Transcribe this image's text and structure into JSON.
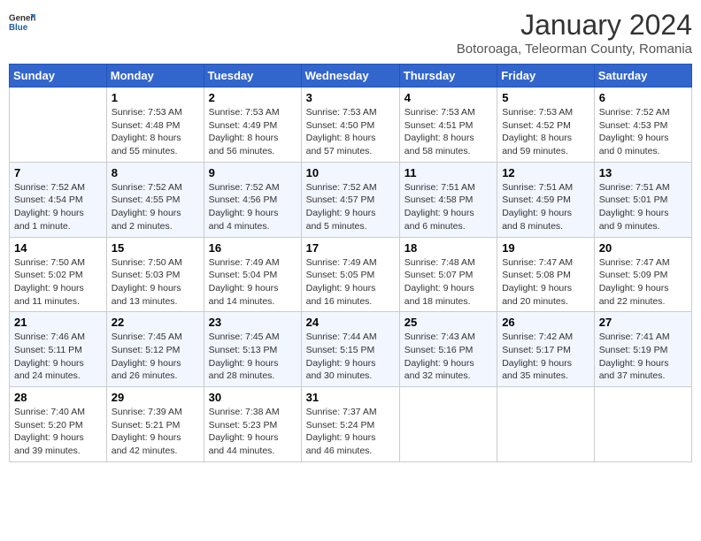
{
  "header": {
    "logo_general": "General",
    "logo_blue": "Blue",
    "title": "January 2024",
    "subtitle": "Botoroaga, Teleorman County, Romania"
  },
  "calendar": {
    "days_of_week": [
      "Sunday",
      "Monday",
      "Tuesday",
      "Wednesday",
      "Thursday",
      "Friday",
      "Saturday"
    ],
    "weeks": [
      [
        {
          "day": "",
          "info": ""
        },
        {
          "day": "1",
          "info": "Sunrise: 7:53 AM\nSunset: 4:48 PM\nDaylight: 8 hours\nand 55 minutes."
        },
        {
          "day": "2",
          "info": "Sunrise: 7:53 AM\nSunset: 4:49 PM\nDaylight: 8 hours\nand 56 minutes."
        },
        {
          "day": "3",
          "info": "Sunrise: 7:53 AM\nSunset: 4:50 PM\nDaylight: 8 hours\nand 57 minutes."
        },
        {
          "day": "4",
          "info": "Sunrise: 7:53 AM\nSunset: 4:51 PM\nDaylight: 8 hours\nand 58 minutes."
        },
        {
          "day": "5",
          "info": "Sunrise: 7:53 AM\nSunset: 4:52 PM\nDaylight: 8 hours\nand 59 minutes."
        },
        {
          "day": "6",
          "info": "Sunrise: 7:52 AM\nSunset: 4:53 PM\nDaylight: 9 hours\nand 0 minutes."
        }
      ],
      [
        {
          "day": "7",
          "info": "Sunrise: 7:52 AM\nSunset: 4:54 PM\nDaylight: 9 hours\nand 1 minute."
        },
        {
          "day": "8",
          "info": "Sunrise: 7:52 AM\nSunset: 4:55 PM\nDaylight: 9 hours\nand 2 minutes."
        },
        {
          "day": "9",
          "info": "Sunrise: 7:52 AM\nSunset: 4:56 PM\nDaylight: 9 hours\nand 4 minutes."
        },
        {
          "day": "10",
          "info": "Sunrise: 7:52 AM\nSunset: 4:57 PM\nDaylight: 9 hours\nand 5 minutes."
        },
        {
          "day": "11",
          "info": "Sunrise: 7:51 AM\nSunset: 4:58 PM\nDaylight: 9 hours\nand 6 minutes."
        },
        {
          "day": "12",
          "info": "Sunrise: 7:51 AM\nSunset: 4:59 PM\nDaylight: 9 hours\nand 8 minutes."
        },
        {
          "day": "13",
          "info": "Sunrise: 7:51 AM\nSunset: 5:01 PM\nDaylight: 9 hours\nand 9 minutes."
        }
      ],
      [
        {
          "day": "14",
          "info": "Sunrise: 7:50 AM\nSunset: 5:02 PM\nDaylight: 9 hours\nand 11 minutes."
        },
        {
          "day": "15",
          "info": "Sunrise: 7:50 AM\nSunset: 5:03 PM\nDaylight: 9 hours\nand 13 minutes."
        },
        {
          "day": "16",
          "info": "Sunrise: 7:49 AM\nSunset: 5:04 PM\nDaylight: 9 hours\nand 14 minutes."
        },
        {
          "day": "17",
          "info": "Sunrise: 7:49 AM\nSunset: 5:05 PM\nDaylight: 9 hours\nand 16 minutes."
        },
        {
          "day": "18",
          "info": "Sunrise: 7:48 AM\nSunset: 5:07 PM\nDaylight: 9 hours\nand 18 minutes."
        },
        {
          "day": "19",
          "info": "Sunrise: 7:47 AM\nSunset: 5:08 PM\nDaylight: 9 hours\nand 20 minutes."
        },
        {
          "day": "20",
          "info": "Sunrise: 7:47 AM\nSunset: 5:09 PM\nDaylight: 9 hours\nand 22 minutes."
        }
      ],
      [
        {
          "day": "21",
          "info": "Sunrise: 7:46 AM\nSunset: 5:11 PM\nDaylight: 9 hours\nand 24 minutes."
        },
        {
          "day": "22",
          "info": "Sunrise: 7:45 AM\nSunset: 5:12 PM\nDaylight: 9 hours\nand 26 minutes."
        },
        {
          "day": "23",
          "info": "Sunrise: 7:45 AM\nSunset: 5:13 PM\nDaylight: 9 hours\nand 28 minutes."
        },
        {
          "day": "24",
          "info": "Sunrise: 7:44 AM\nSunset: 5:15 PM\nDaylight: 9 hours\nand 30 minutes."
        },
        {
          "day": "25",
          "info": "Sunrise: 7:43 AM\nSunset: 5:16 PM\nDaylight: 9 hours\nand 32 minutes."
        },
        {
          "day": "26",
          "info": "Sunrise: 7:42 AM\nSunset: 5:17 PM\nDaylight: 9 hours\nand 35 minutes."
        },
        {
          "day": "27",
          "info": "Sunrise: 7:41 AM\nSunset: 5:19 PM\nDaylight: 9 hours\nand 37 minutes."
        }
      ],
      [
        {
          "day": "28",
          "info": "Sunrise: 7:40 AM\nSunset: 5:20 PM\nDaylight: 9 hours\nand 39 minutes."
        },
        {
          "day": "29",
          "info": "Sunrise: 7:39 AM\nSunset: 5:21 PM\nDaylight: 9 hours\nand 42 minutes."
        },
        {
          "day": "30",
          "info": "Sunrise: 7:38 AM\nSunset: 5:23 PM\nDaylight: 9 hours\nand 44 minutes."
        },
        {
          "day": "31",
          "info": "Sunrise: 7:37 AM\nSunset: 5:24 PM\nDaylight: 9 hours\nand 46 minutes."
        },
        {
          "day": "",
          "info": ""
        },
        {
          "day": "",
          "info": ""
        },
        {
          "day": "",
          "info": ""
        }
      ]
    ]
  }
}
